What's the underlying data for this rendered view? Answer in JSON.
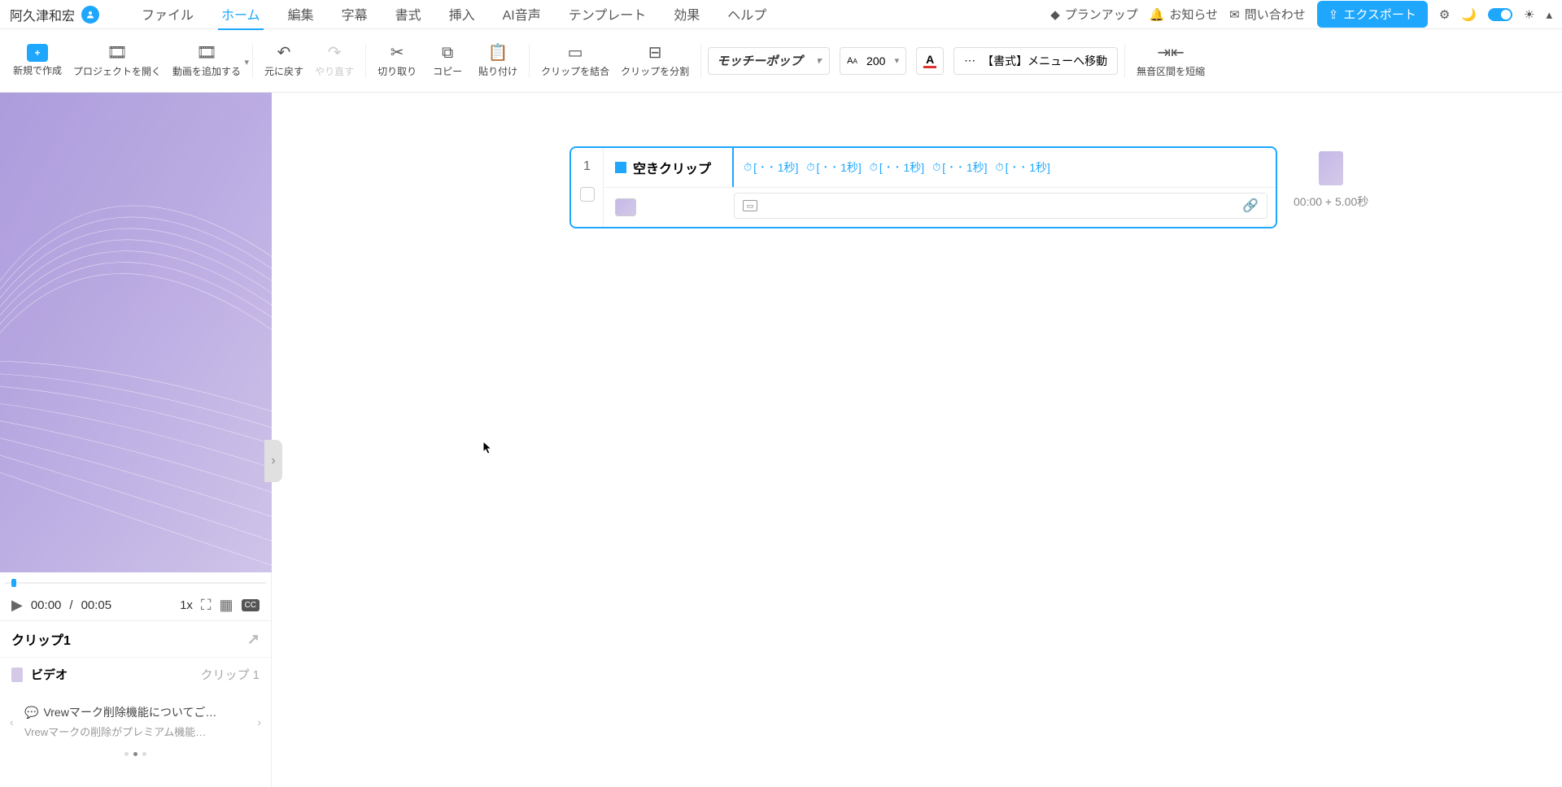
{
  "user": {
    "name": "阿久津和宏"
  },
  "menu": {
    "file": "ファイル",
    "home": "ホーム",
    "edit": "編集",
    "subtitle": "字幕",
    "format": "書式",
    "insert": "挿入",
    "ai_voice": "AI音声",
    "template": "テンプレート",
    "effect": "効果",
    "help": "ヘルプ"
  },
  "header_right": {
    "plan_up": "プランアップ",
    "notice": "お知らせ",
    "inquiry": "問い合わせ",
    "export": "エクスポート"
  },
  "toolbar": {
    "new_create": "新規で作成",
    "open_project": "プロジェクトを開く",
    "add_video": "動画を追加する",
    "undo": "元に戻す",
    "redo": "やり直す",
    "cut": "切り取り",
    "copy": "コピー",
    "paste": "貼り付け",
    "merge_clip": "クリップを結合",
    "split_clip": "クリップを分割",
    "font_name": "モッチーポップ",
    "font_size": "200",
    "format_menu": "【書式】メニューへ移動",
    "shorten_silence": "無音区間を短縮"
  },
  "preview": {
    "current_time": "00:00",
    "total_time": "00:05",
    "time_separator": "/",
    "speed": "1x"
  },
  "clip_panel": {
    "title": "クリップ1",
    "video_label": "ビデオ",
    "video_meta": "クリップ 1"
  },
  "notice_panel": {
    "title": "Vrewマーク削除機能についてご…",
    "subtitle": "Vrewマークの削除がプレミアム機能…"
  },
  "clip_card": {
    "index": "1",
    "title": "空きクリップ",
    "segments": [
      "[ ･ ･ 1秒]",
      "[ ･ ･ 1秒]",
      "[ ･ ･ 1秒]",
      "[ ･ ･ 1秒]",
      "[ ･ ･ 1秒]"
    ]
  },
  "side_thumb": {
    "time": "00:00 + 5.00秒"
  }
}
